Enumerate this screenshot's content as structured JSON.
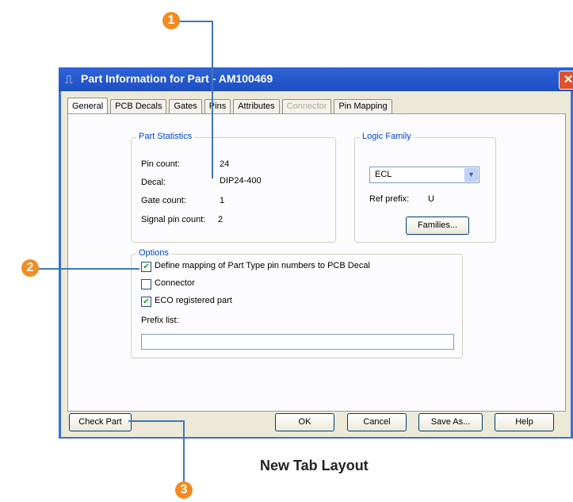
{
  "dialog": {
    "title": "Part Information for Part - AM100469",
    "app_icon": "part-icon",
    "close_icon": "close-icon"
  },
  "tabs": [
    {
      "label": "General",
      "active": true,
      "enabled": true
    },
    {
      "label": "PCB Decals",
      "active": false,
      "enabled": true
    },
    {
      "label": "Gates",
      "active": false,
      "enabled": true
    },
    {
      "label": "Pins",
      "active": false,
      "enabled": true
    },
    {
      "label": "Attributes",
      "active": false,
      "enabled": true
    },
    {
      "label": "Connector",
      "active": false,
      "enabled": false
    },
    {
      "label": "Pin Mapping",
      "active": false,
      "enabled": true
    }
  ],
  "part_statistics": {
    "legend": "Part Statistics",
    "rows": [
      {
        "label": "Pin count:",
        "value": "24"
      },
      {
        "label": "Decal:",
        "value": "DIP24-400"
      },
      {
        "label": "Gate count:",
        "value": "1"
      },
      {
        "label": "Signal pin count:",
        "value": "2"
      }
    ]
  },
  "logic_family": {
    "legend": "Logic Family",
    "selected": "ECL",
    "ref_prefix_label": "Ref prefix:",
    "ref_prefix_value": "U",
    "families_button": "Families..."
  },
  "options": {
    "legend": "Options",
    "checkboxes": [
      {
        "label": "Define mapping of Part Type pin numbers to PCB Decal",
        "checked": true
      },
      {
        "label": "Connector",
        "checked": false
      },
      {
        "label": "ECO registered part",
        "checked": true
      }
    ],
    "prefix_list_label": "Prefix list:",
    "prefix_list_value": ""
  },
  "buttons": {
    "check_part": "Check Part",
    "ok": "OK",
    "cancel": "Cancel",
    "save_as": "Save As...",
    "help": "Help"
  },
  "callouts": [
    "1",
    "2",
    "3"
  ],
  "caption": "New Tab Layout",
  "colors": {
    "callout": "#f08c22",
    "leader_line": "#3f78b9",
    "titlebar": "#2f63d6",
    "group_legend": "#0046d5"
  }
}
